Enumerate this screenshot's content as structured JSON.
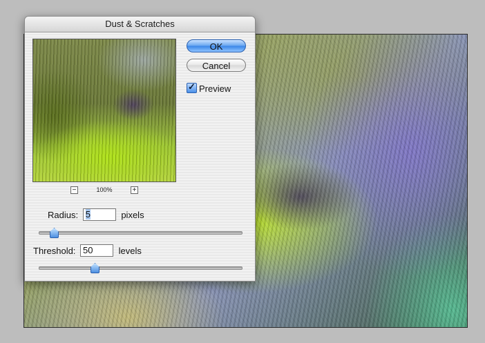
{
  "dialog": {
    "title": "Dust & Scratches",
    "zoom_level": "100%",
    "zoom_out_symbol": "−",
    "zoom_in_symbol": "+",
    "ok_label": "OK",
    "cancel_label": "Cancel",
    "preview_label": "Preview",
    "preview_checked": true,
    "radius": {
      "label": "Radius:",
      "value": "5",
      "unit": "pixels",
      "slider_fraction": 0.07
    },
    "threshold": {
      "label": "Threshold:",
      "value": "50",
      "unit": "levels",
      "slider_fraction": 0.27
    }
  },
  "colors": {
    "accent": "#3a86e8",
    "dialog_bg": "#ececec"
  }
}
